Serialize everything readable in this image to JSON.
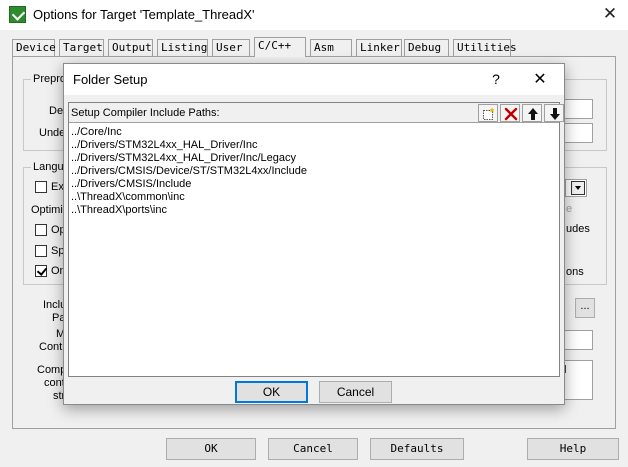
{
  "window": {
    "title": "Options for Target 'Template_ThreadX'",
    "close_glyph": "✕"
  },
  "tabs": [
    {
      "label": "Device"
    },
    {
      "label": "Target"
    },
    {
      "label": "Output"
    },
    {
      "label": "Listing"
    },
    {
      "label": "User"
    },
    {
      "label": "C/C++",
      "active": true
    },
    {
      "label": "Asm"
    },
    {
      "label": "Linker"
    },
    {
      "label": "Debug"
    },
    {
      "label": "Utilities"
    }
  ],
  "background": {
    "preprocessor_group": "Prepro",
    "define_label": "Def",
    "undefine_label": "Undef",
    "language_group": "Langu",
    "check_ex": "Ex",
    "optimize_label": "Optimiz",
    "check_op": "Op",
    "check_sp": "Sp",
    "check_on": "On",
    "right_e": "e",
    "right_udes": "udes",
    "right_ons": "ons",
    "include_label": "Inclu",
    "paths_label": "Pat",
    "misc_label": "M",
    "controls_label": "Contr",
    "compiler_label": "Comp",
    "control_label": "cont",
    "string_label": "stri",
    "browse_ellipsis": "...",
    "scroll_l": "l"
  },
  "footer": {
    "ok": "OK",
    "cancel": "Cancel",
    "defaults": "Defaults",
    "help": "Help"
  },
  "dialog": {
    "title": "Folder Setup",
    "help_glyph": "?",
    "close_glyph": "✕",
    "list_header": "Setup Compiler Include Paths:",
    "toolbar_icons": [
      "new-folder-icon",
      "delete-x-icon",
      "move-up-icon",
      "move-down-icon"
    ],
    "paths": [
      "../Core/Inc",
      "../Drivers/STM32L4xx_HAL_Driver/Inc",
      "../Drivers/STM32L4xx_HAL_Driver/Inc/Legacy",
      "../Drivers/CMSIS/Device/ST/STM32L4xx/Include",
      "../Drivers/CMSIS/Include",
      "..\\ThreadX\\common\\inc",
      "..\\ThreadX\\ports\\inc"
    ],
    "ok": "OK",
    "cancel": "Cancel",
    "accent_color": "#0078d7"
  }
}
